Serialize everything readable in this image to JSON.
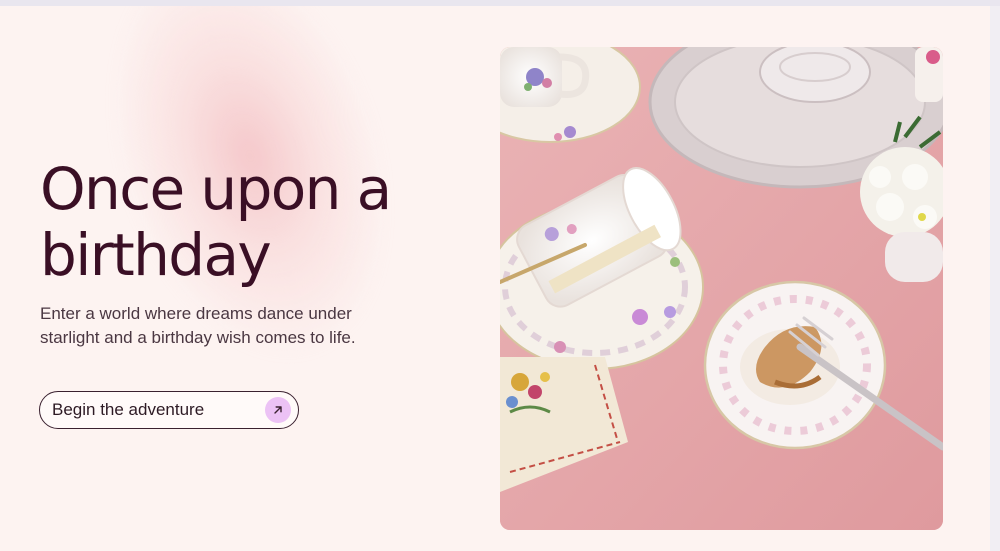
{
  "hero": {
    "headline_line1": "Once upon a",
    "headline_line2": "birthday",
    "subtext_line1": "Enter a world where dreams dance under",
    "subtext_line2": "starlight and a birthday wish comes to life.",
    "cta_label": "Begin the adventure",
    "cta_icon": "arrow-up-right-icon"
  },
  "colors": {
    "page_background": "#fdf3f1",
    "headline": "#3a0f25",
    "cta_icon_background": "#ecc2f5",
    "tablecloth": "#e6a5a8"
  }
}
